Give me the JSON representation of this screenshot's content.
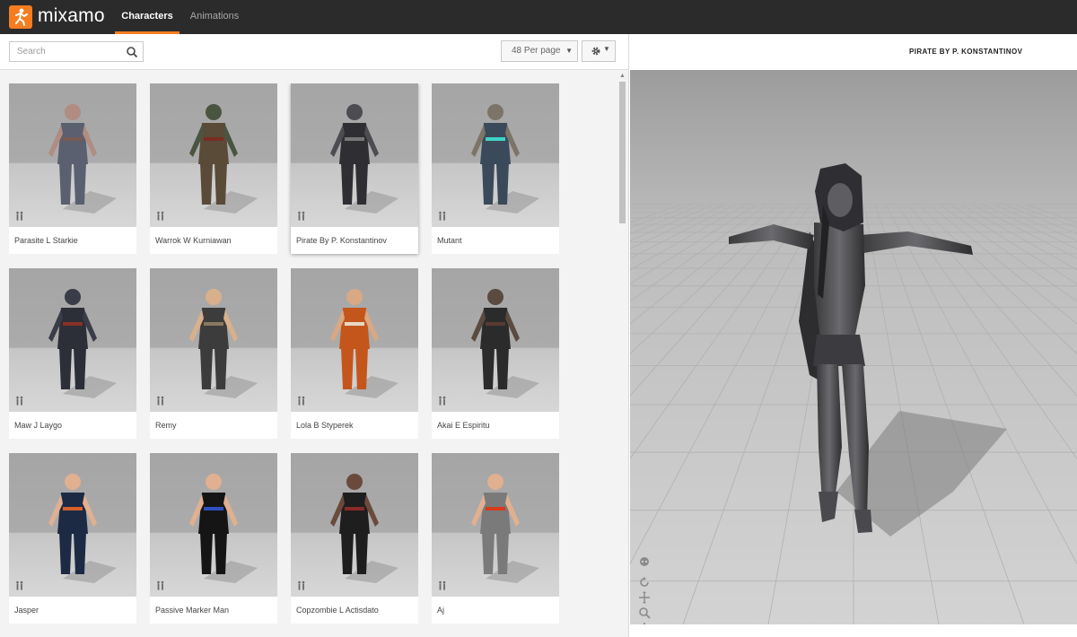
{
  "app": {
    "brand": "mixamo",
    "nav": [
      {
        "label": "Characters",
        "active": true
      },
      {
        "label": "Animations",
        "active": false
      }
    ],
    "accent": "#f57d20"
  },
  "toolbar": {
    "search_placeholder": "Search",
    "per_page": "48 Per page"
  },
  "characters": [
    {
      "name": "Parasite L Starkie"
    },
    {
      "name": "Warrok W Kurniawan"
    },
    {
      "name": "Pirate By P. Konstantinov",
      "selected": true
    },
    {
      "name": "Mutant"
    },
    {
      "name": "Maw J Laygo"
    },
    {
      "name": "Remy"
    },
    {
      "name": "Lola B Styperek"
    },
    {
      "name": "Akai E Espiritu"
    },
    {
      "name": "Jasper"
    },
    {
      "name": "Passive Marker Man"
    },
    {
      "name": "Copzombie L Actisdato"
    },
    {
      "name": "Aj"
    }
  ],
  "viewer": {
    "title": "PIRATE BY P. KONSTANTINOV",
    "tools": [
      "skull-icon",
      "rotate-icon",
      "move-icon",
      "zoom-icon",
      "power-icon",
      "camera-icon"
    ]
  }
}
